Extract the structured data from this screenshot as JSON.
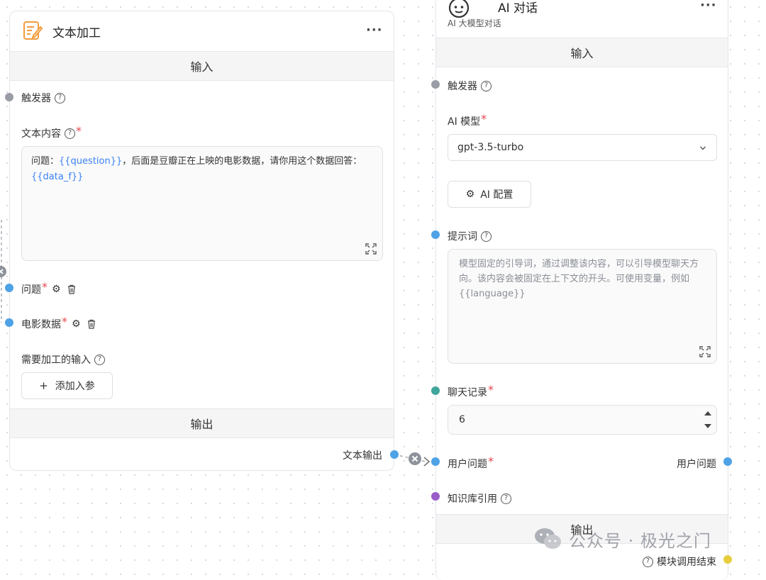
{
  "left_node": {
    "title": "文本加工",
    "more": "···",
    "input_section": "输入",
    "trigger": "触发器",
    "text_content_label": "文本内容",
    "text_parts": [
      "问题：",
      "{{question}}",
      "，后面是豆瓣正在上映的电影数据，请你用这个数据回答：",
      "{{data_f}}"
    ],
    "param_question": "问题",
    "param_movie_data": "电影数据",
    "inputs_to_process": "需要加工的输入",
    "add_param_button": "添加入参",
    "add_symbol": "+",
    "output_section": "输出",
    "text_output": "文本输出"
  },
  "right_node": {
    "title": "AI 对话",
    "subtitle": "AI 大模型对话",
    "more": "···",
    "input_section": "输入",
    "trigger": "触发器",
    "model_label": "AI 模型",
    "model_value": "gpt-3.5-turbo",
    "ai_config_button": "AI 配置",
    "prompt_label": "提示词",
    "prompt_placeholder": "模型固定的引导词，通过调整该内容，可以引导模型聊天方向。该内容会被固定在上下文的开头。可使用变量，例如 {{language}}",
    "chat_history_label": "聊天记录",
    "chat_history_value": "6",
    "user_question_label": "用户问题",
    "user_question_output": "用户问题",
    "knowledge_label": "知识库引用",
    "output_section": "输出",
    "module_end": "模块调用结束"
  },
  "watermark": "公众号 · 极光之门",
  "colors": {
    "accent_blue": "#4ea2e6",
    "required_red": "#e5484d",
    "variable_blue": "#3b82f6",
    "handle_gray": "#9a9da5",
    "handle_teal": "#3fa59a",
    "handle_purple": "#9a5cc9",
    "handle_yellow": "#e7cd3e",
    "icon_orange": "#f39c3d"
  }
}
